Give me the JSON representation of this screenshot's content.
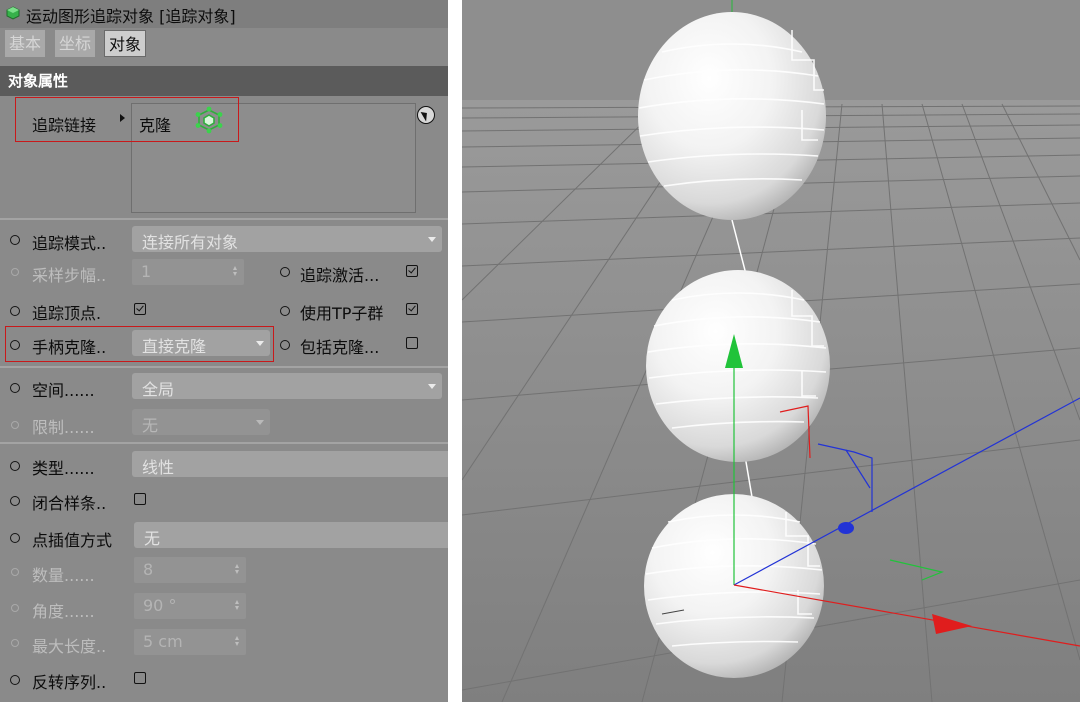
{
  "panel": {
    "title": "运动图形追踪对象 [追踪对象]",
    "tabs": [
      {
        "label": "基本",
        "active": false
      },
      {
        "label": "坐标",
        "active": false
      },
      {
        "label": "对象",
        "active": true
      }
    ],
    "section_title": "对象属性",
    "trace_link": {
      "label": "追踪链接",
      "item": "克隆",
      "item_icon": "cloner-icon"
    },
    "trace_mode": {
      "label": "追踪模式",
      "dots": "..",
      "value": "连接所有对象"
    },
    "sample_step": {
      "label": "采样步幅",
      "dots": "..",
      "value": "1"
    },
    "trace_active": {
      "label": "追踪激活",
      "dots": "...",
      "checked": true
    },
    "trace_vertices": {
      "label": "追踪顶点",
      "dots": ".",
      "checked": true
    },
    "use_tp": {
      "label": "使用TP子群",
      "checked": true
    },
    "handle_clone": {
      "label": "手柄克隆",
      "dots": "..",
      "value": "直接克隆"
    },
    "include_clone": {
      "label": "包括克隆",
      "dots": "...",
      "checked": false
    },
    "space": {
      "label": "空间",
      "dots": "......",
      "value": "全局"
    },
    "limit": {
      "label": "限制",
      "dots": "......",
      "value": "无"
    },
    "type": {
      "label": "类型",
      "dots": "......",
      "value": "线性"
    },
    "close_spline": {
      "label": "闭合样条",
      "dots": "..",
      "checked": false
    },
    "interpolation": {
      "label": "点插值方式",
      "value": "无"
    },
    "count": {
      "label": "数量",
      "dots": "......",
      "value": "8"
    },
    "angle": {
      "label": "角度",
      "dots": "......",
      "value": "90 °"
    },
    "max_length": {
      "label": "最大长度",
      "dots": "..",
      "value": "5 cm"
    },
    "reverse": {
      "label": "反转序列",
      "dots": "..",
      "checked": false
    }
  },
  "colors": {
    "panel_bg": "#8a8a8a",
    "section_bar": "#5b5b5b",
    "highlight": "#c8191b",
    "axis_x": "#e01d1d",
    "axis_y": "#21c33a",
    "axis_z": "#2233d6",
    "viewport_bg": "#8a8a8a"
  }
}
